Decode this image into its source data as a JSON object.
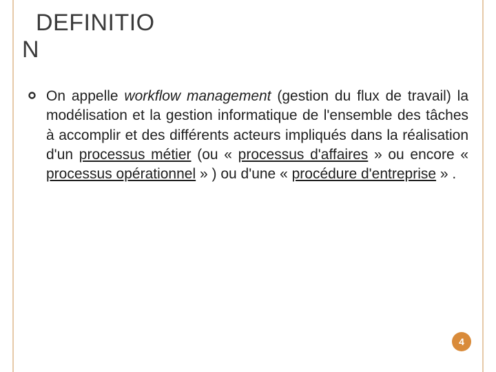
{
  "slide": {
    "title_line1": "DEFINITIO",
    "title_line2": "N",
    "body": {
      "leadin": "On appelle ",
      "italic_term": "workflow  management",
      "after_term": " (gestion du flux de travail) la modélisation et la gestion informatique de l'ensemble des tâches à accomplir et des différents acteurs impliqués dans la réalisation d'un ",
      "link1": "processus métier",
      "mid1": " (ou « ",
      "link2": "processus d'affaires",
      "mid2": " » ou encore « ",
      "link3": "processus opérationnel",
      "mid3": " » ) ou d'une « ",
      "link4": "procédure d'entreprise",
      "tail": " » ."
    },
    "page_number": "4"
  },
  "colors": {
    "frame_border": "#e6c9a8",
    "page_dot": "#d98b3a",
    "title_text": "#3a3a3a",
    "body_text": "#1e1e1e"
  }
}
